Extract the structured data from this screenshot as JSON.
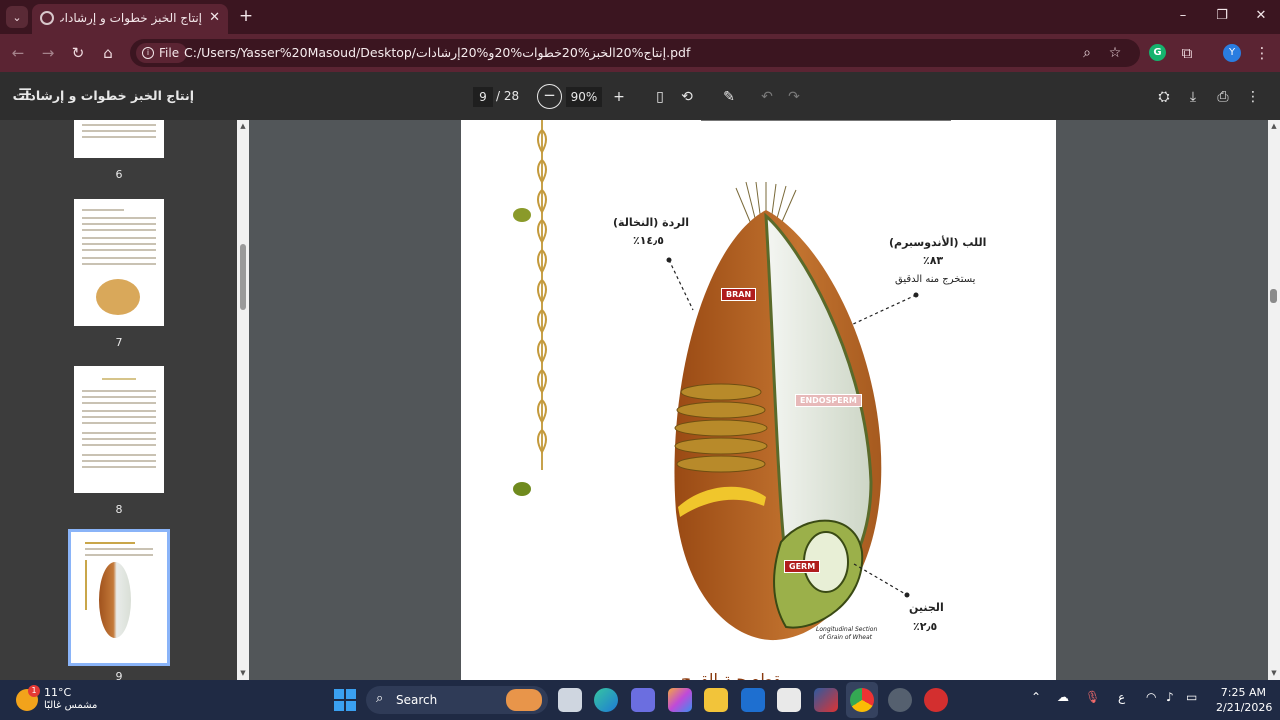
{
  "browser": {
    "tab_title": "إنتاج الخبز خطوات و إرشادات",
    "new_tab": "+",
    "close_tab": "✕",
    "window_controls": [
      "–",
      "❐",
      "✕"
    ],
    "site_chip": "File",
    "url": "C:/Users/Yasser%20Masoud/Desktop/إنتاج%20الخبز%20خطوات%20و%20إرشادات.pdf",
    "profile_initial": "Y"
  },
  "pdf_toolbar": {
    "title": "إنتاج الخبز خطوات و إرشادات",
    "current_page": "9",
    "total_pages": "/ 28",
    "zoom": "90%"
  },
  "thumbnails": [
    {
      "number": "6"
    },
    {
      "number": "7"
    },
    {
      "number": "8"
    },
    {
      "number": "9",
      "selected": true
    }
  ],
  "diagram": {
    "bran_label": "الردة (النخالة)",
    "bran_percent": "١٤٫٥٪",
    "bran_tag": "BRAN",
    "endosperm_label": "اللب (الأندوسبرم)",
    "endosperm_percent": "٨٣٪",
    "endosperm_note": "يستخرج منه الدقيق",
    "endosperm_tag": "ENDOSPERM",
    "germ_label": "الجنين",
    "germ_percent": "٢٫٥٪",
    "germ_tag": "GERM",
    "caption_line1": "Longitudinal Section",
    "caption_line2": "of Grain of Wheat",
    "bottom_heading": "مقطع حبة القمح"
  },
  "taskbar": {
    "temperature": "11°C",
    "condition": "مشمس غالبًا",
    "weather_badge": "1",
    "search_label": "Search",
    "language": "ع",
    "time": "7:25 AM",
    "date": "2/21/2026"
  },
  "colors": {
    "tab_strip": "#3b1520",
    "toolbar": "#5b2433",
    "pdf_bar": "#2e2e2e",
    "taskbar": "#1f2a44",
    "selection": "#8ab4f8"
  }
}
